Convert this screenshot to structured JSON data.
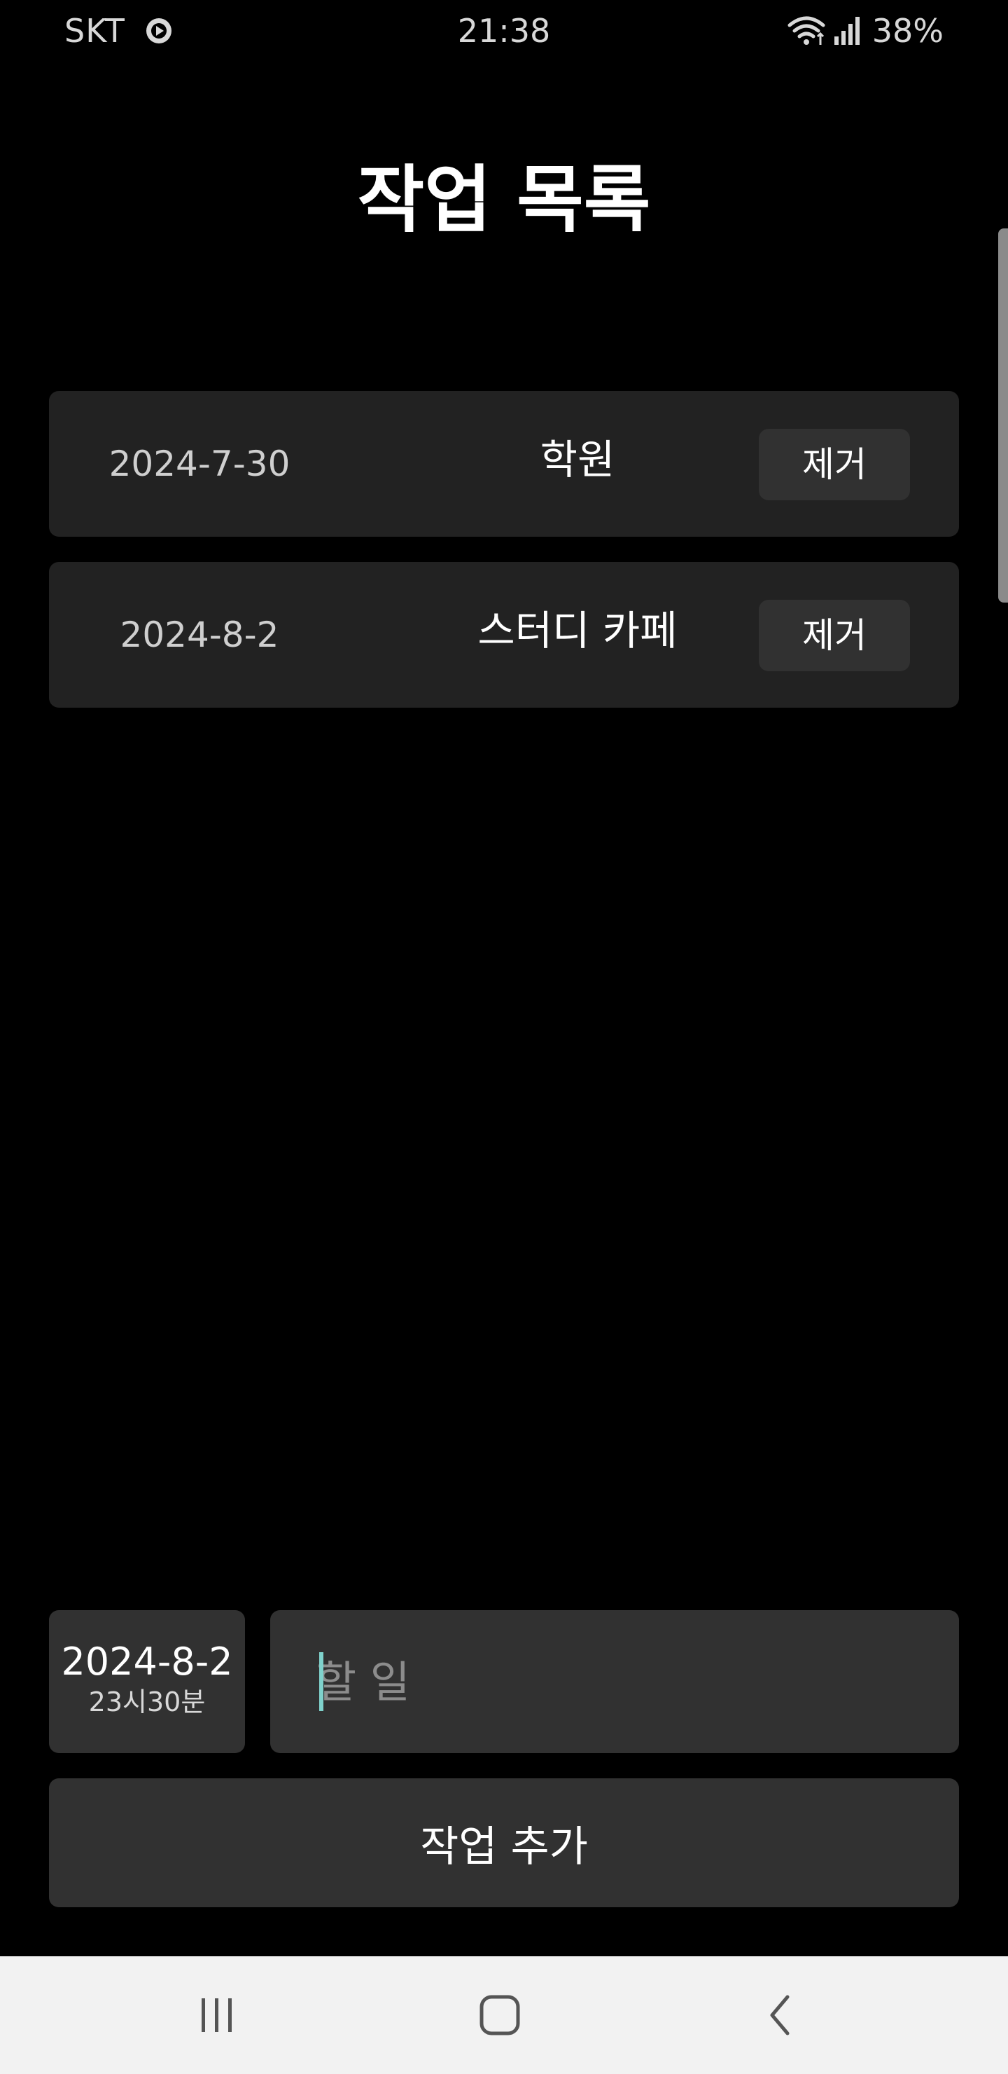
{
  "status_bar": {
    "carrier": "SKT",
    "time": "21:38",
    "battery": "38%",
    "icons": [
      "play-circle-icon",
      "wifi-icon",
      "signal-icon"
    ]
  },
  "page": {
    "title": "작업 목록"
  },
  "tasks": [
    {
      "date": "2024-7-30",
      "name": "학원",
      "remove_label": "제거"
    },
    {
      "date": "2024-8-2",
      "name": "스터디 카페",
      "remove_label": "제거"
    }
  ],
  "input_area": {
    "selected_date": "2024-8-2",
    "selected_time": "23시30분",
    "task_placeholder": "할 일",
    "task_value": "",
    "add_button_label": "작업 추가"
  },
  "nav_bar": {
    "buttons": [
      "recent-apps-icon",
      "home-icon",
      "back-icon"
    ]
  },
  "colors": {
    "background": "#000000",
    "card": "#222222",
    "button": "#313131",
    "cursor": "#7fd2cc",
    "nav_bar": "#f2f2f2"
  }
}
